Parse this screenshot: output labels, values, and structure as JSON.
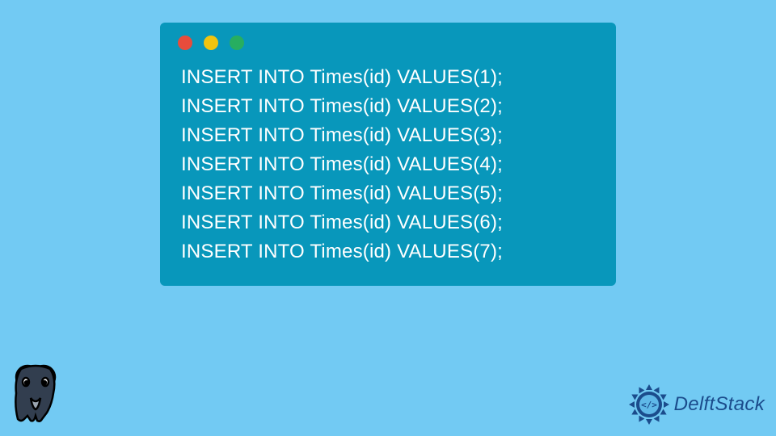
{
  "code": {
    "lines": [
      "INSERT INTO Times(id) VALUES(1);",
      "INSERT INTO Times(id) VALUES(2);",
      "INSERT INTO Times(id) VALUES(3);",
      "INSERT INTO Times(id) VALUES(4);",
      "INSERT INTO Times(id) VALUES(5);",
      "INSERT INTO Times(id) VALUES(6);",
      "INSERT INTO Times(id) VALUES(7);"
    ]
  },
  "branding": {
    "site_name": "DelftStack"
  }
}
